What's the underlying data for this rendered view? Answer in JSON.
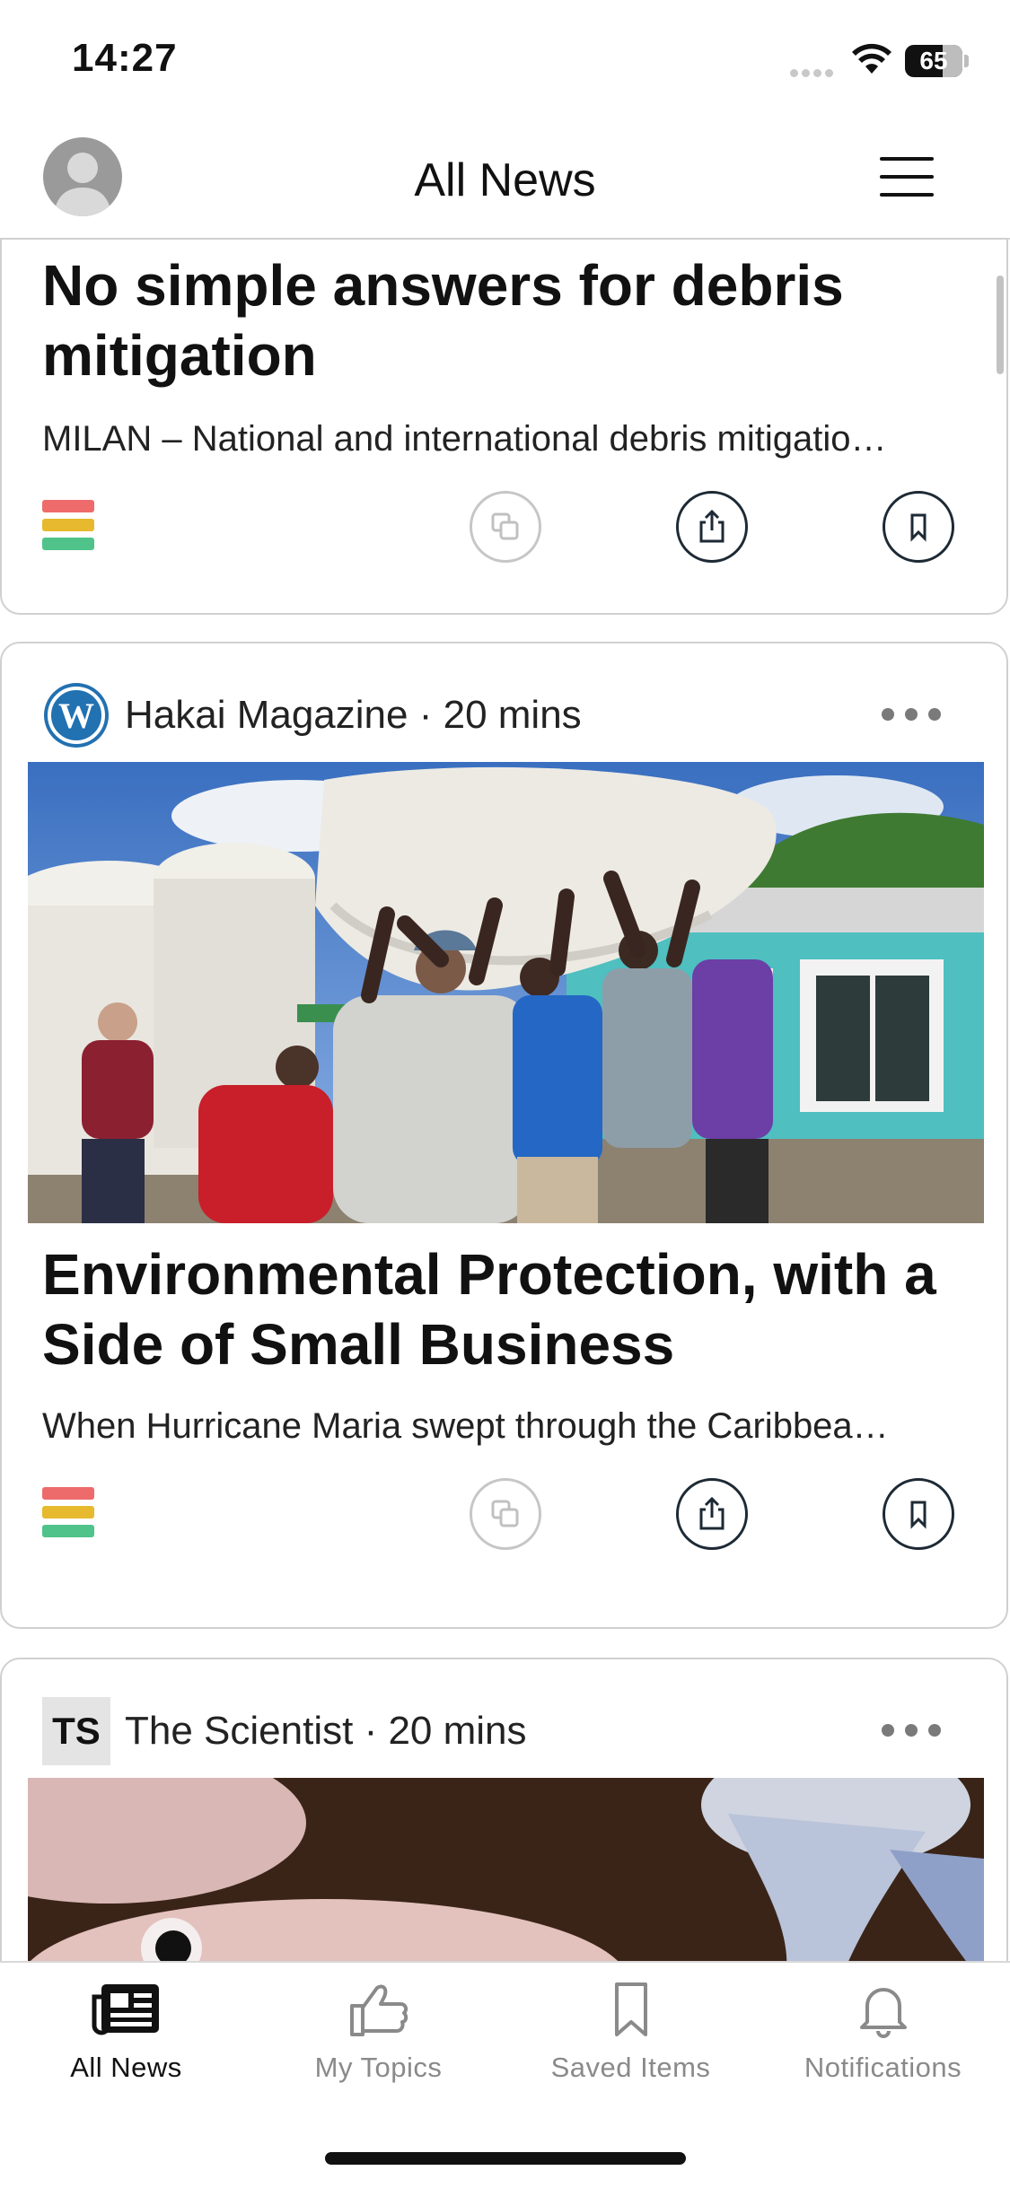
{
  "status_bar": {
    "time": "14:27",
    "battery": "65"
  },
  "header": {
    "title": "All News"
  },
  "articles": [
    {
      "headline": "No simple answers for debris mitigation",
      "summary": "MILAN – National and international debris mitigatio…",
      "stripe_colors": [
        "#ee6b6b",
        "#e6b92e",
        "#4fc38a"
      ]
    },
    {
      "source": "Hakai Magazine",
      "age": "20 mins",
      "headline": "Environmental Protection, with a Side of Small Business",
      "summary": "When Hurricane Maria swept through the Caribbea…",
      "stripe_colors": [
        "#ee6b6b",
        "#e6b92e",
        "#4fc38a"
      ]
    },
    {
      "source_logo": "TS",
      "source": "The Scientist",
      "age": "20 mins"
    }
  ],
  "tabs": [
    {
      "label": "All News",
      "icon": "newspaper-icon",
      "active": true
    },
    {
      "label": "My Topics",
      "icon": "thumbs-up-icon",
      "active": false
    },
    {
      "label": "Saved Items",
      "icon": "bookmark-icon",
      "active": false
    },
    {
      "label": "Notifications",
      "icon": "bell-icon",
      "active": false
    }
  ]
}
